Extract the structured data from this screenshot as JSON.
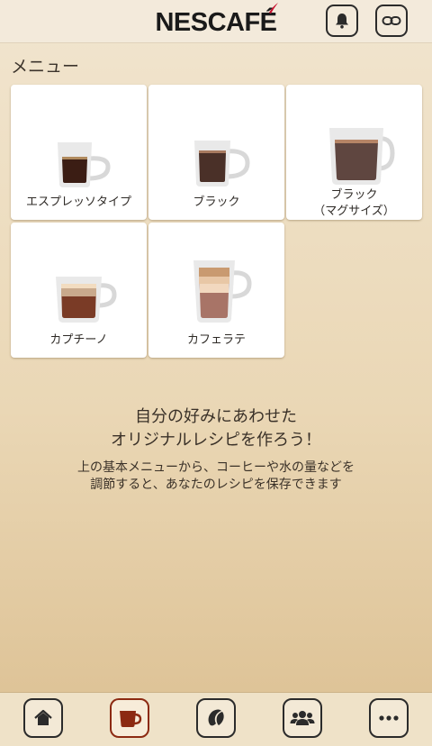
{
  "header": {
    "logo_text": "NESCAFÉ",
    "notifications_icon": "bell-icon",
    "link_icon": "link-icon"
  },
  "menu": {
    "title": "メニュー",
    "items": [
      {
        "label_line1": "エスプレッソタイプ",
        "label_line2": "",
        "cup": "espresso"
      },
      {
        "label_line1": "ブラック",
        "label_line2": "",
        "cup": "black"
      },
      {
        "label_line1": "ブラック",
        "label_line2": "（マグサイズ）",
        "cup": "mug"
      },
      {
        "label_line1": "カプチーノ",
        "label_line2": "",
        "cup": "cappuccino"
      },
      {
        "label_line1": "カフェラテ",
        "label_line2": "",
        "cup": "latte"
      }
    ]
  },
  "promo": {
    "headline_line1": "自分の好みにあわせた",
    "headline_line2": "オリジナルレシピを作ろう！",
    "body_line1": "上の基本メニューから、コーヒーや水の量などを",
    "body_line2": "調節すると、あなたのレシピを保存できます"
  },
  "tabbar": {
    "tabs": [
      {
        "icon": "home-icon",
        "active": false
      },
      {
        "icon": "cup-icon",
        "active": true
      },
      {
        "icon": "coffee-bean-icon",
        "active": false
      },
      {
        "icon": "people-icon",
        "active": false
      },
      {
        "icon": "more-icon",
        "active": false
      }
    ]
  },
  "colors": {
    "brand_red": "#c8102e",
    "active_tab": "#8c2a12",
    "espresso": "#3b1d14",
    "black_coffee": "#4a3028",
    "mug_coffee": "#5f4640",
    "cappuccino_body": "#7a3b26",
    "latte_milk": "#a87467"
  }
}
